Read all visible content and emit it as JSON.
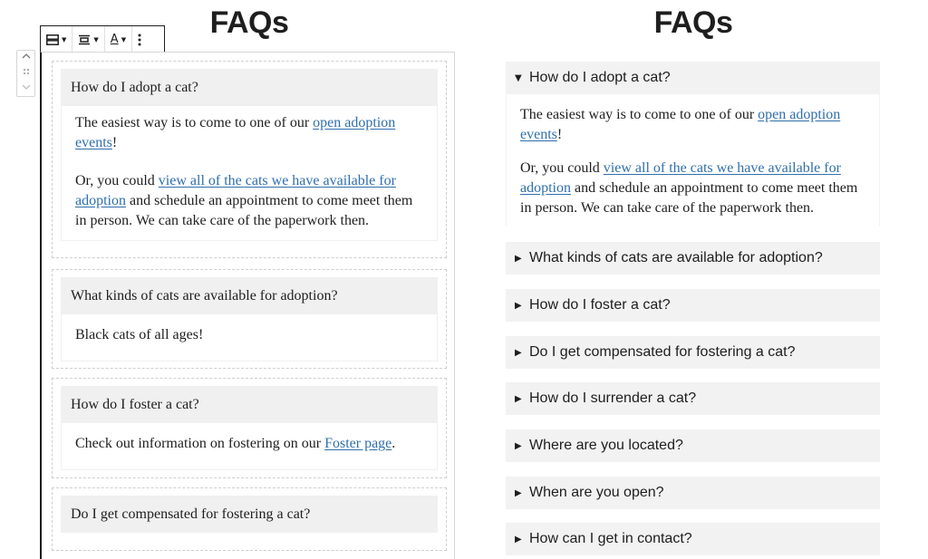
{
  "left_title": "FAQs",
  "right_title": "FAQs",
  "toolbar": {
    "block_icon": "group-block-icon",
    "align_icon": "align-center-icon",
    "text_color_icon": "text-color-icon",
    "text_color_letter": "A",
    "more_icon": "more-options-icon"
  },
  "mover": {
    "up_icon": "chevron-up-icon",
    "drag_icon": "drag-handle-icon",
    "down_icon": "chevron-down-icon"
  },
  "editor": {
    "items": [
      {
        "question": "How do I adopt a cat?",
        "a1_pre": "The easiest way is to come to one of our ",
        "a1_link": "open adoption events",
        "a1_post": "!",
        "a2_pre": "Or, you could ",
        "a2_link": "view all of the cats we have available for adoption",
        "a2_post": " and schedule an appointment to come meet them in person. We can take care of the paperwork then."
      },
      {
        "question": "What kinds of cats are available for adoption?",
        "answer": "Black cats of all ages!"
      },
      {
        "question": "How do I foster a cat?",
        "a_pre": "Check out information on fostering on our ",
        "a_link": "Foster page",
        "a_post": "."
      },
      {
        "question": "Do I get compensated for fostering a cat?"
      }
    ]
  },
  "frontend": {
    "items": [
      {
        "question": "How do I adopt a cat?",
        "a1_pre": "The easiest way is to come to one of our ",
        "a1_link": "open adoption events",
        "a1_post": "!",
        "a2_pre": "Or, you could ",
        "a2_link": "view all of the cats we have available for adoption",
        "a2_post": " and schedule an appointment to come meet them in person. We can take care of the paperwork then."
      },
      {
        "question": "What kinds of cats are available for adoption?"
      },
      {
        "question": "How do I foster a cat?"
      },
      {
        "question": "Do I get compensated for fostering a cat?"
      },
      {
        "question": "How do I surrender a cat?"
      },
      {
        "question": "Where are you located?"
      },
      {
        "question": "When are you open?"
      },
      {
        "question": "How can I get in contact?"
      }
    ],
    "open_marker": "▼",
    "closed_marker": "▶"
  }
}
